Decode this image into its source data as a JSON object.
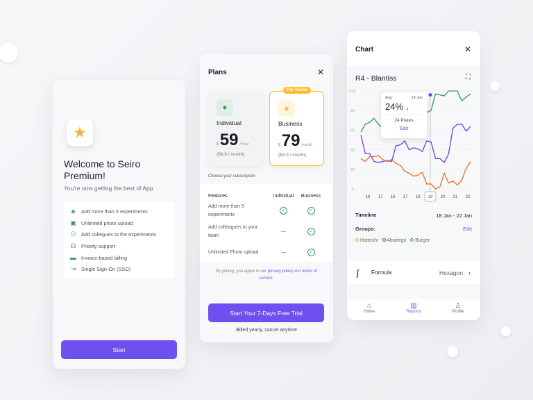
{
  "welcome": {
    "icon": "star-icon",
    "title": "Welcome to Seiro Premium!",
    "subtitle": "You're now getting the best of App",
    "features": [
      {
        "icon": "layers-icon",
        "label": "Add more than 5 experiments"
      },
      {
        "icon": "image-icon",
        "label": "Unlimited photo upload"
      },
      {
        "icon": "user-plus-icon",
        "label": "Add collegues to the experiments"
      },
      {
        "icon": "headset-icon",
        "label": "Priority support"
      },
      {
        "icon": "gift-card-icon",
        "label": "Invoice-based billing"
      },
      {
        "icon": "login-icon",
        "label": "Single Sign-On (SSO)"
      }
    ],
    "start_label": "Start"
  },
  "plans": {
    "title": "Plans",
    "individual": {
      "name": "Individual",
      "currency": "$",
      "price": "59",
      "period": "/ Year",
      "monthly": "($6.9 / month)"
    },
    "business": {
      "badge": "For Teams",
      "name": "Business",
      "currency": "$",
      "price": "79",
      "period": "/month",
      "monthly": "($8.9 / month)"
    },
    "choose": "Choose your subscription",
    "table": {
      "headers": [
        "Features",
        "Individual",
        "Business"
      ],
      "rows": [
        {
          "feature": "Add more than 5 experiments",
          "individual": true,
          "business": true
        },
        {
          "feature": "Add colleagues to your team",
          "individual": false,
          "business": true
        },
        {
          "feature": "Unlimited Photo upload",
          "individual": false,
          "business": true
        }
      ]
    },
    "legal": {
      "pre": "By joining, you agree to our ",
      "privacy": "privacy policy",
      "mid": " and ",
      "terms": "terms of service",
      "post": "."
    },
    "cta": "Start Your 7-Days Free Trial",
    "billing": "Billed yearly, cancel anytime"
  },
  "chart": {
    "title": "Chart",
    "subtitle": "R4 - Blantiss",
    "tooltip": {
      "label": "Avg:",
      "date": "19 Jan",
      "value": "24%",
      "plates": "24 Plates",
      "edit": "Edit"
    },
    "timeline_label": "Timeline",
    "timeline_value": "18 Jan - 22 Jan",
    "groups_label": "Groups:",
    "groups_edit": "Edit",
    "groups": [
      {
        "name": "Hottechi",
        "color": "#f5a623"
      },
      {
        "name": "Abstergo",
        "color": "#e02424"
      },
      {
        "name": "Burger",
        "color": "#2f9a5c"
      }
    ],
    "formula_label": "Formula",
    "formula_value": "Hexagon",
    "nav": [
      {
        "label": "Home",
        "icon": "home-icon"
      },
      {
        "label": "Reports",
        "icon": "bar-chart-icon",
        "active": true
      },
      {
        "label": "Profile",
        "icon": "user-icon"
      }
    ]
  },
  "chart_data": {
    "type": "line",
    "categories": [
      "18",
      "17",
      "16",
      "17",
      "18",
      "19",
      "20",
      "21",
      "22"
    ],
    "highlight": "19",
    "ylim": [
      0,
      100
    ],
    "yticks": [
      0,
      20,
      40,
      60,
      80,
      100
    ],
    "grid": true,
    "series": [
      {
        "color": "#2f9a5c",
        "values": [
          58,
          66,
          68,
          72,
          66,
          62,
          60,
          62,
          64,
          66,
          68,
          70,
          72,
          74,
          76,
          78,
          80,
          97,
          96,
          95,
          100,
          100,
          100,
          90,
          94,
          97
        ]
      },
      {
        "color": "#6e3cf5",
        "values": [
          55,
          36,
          36,
          28,
          27,
          28,
          29,
          28,
          44,
          45,
          49,
          40,
          42,
          41,
          38,
          49,
          48,
          31,
          31,
          27,
          36,
          62,
          66,
          66,
          59,
          64
        ]
      },
      {
        "color": "#f26b1d",
        "values": [
          31,
          28,
          33,
          33,
          34,
          30,
          28,
          30,
          26,
          24,
          18,
          16,
          13,
          14,
          17,
          5,
          5,
          0,
          2,
          16,
          6,
          8,
          4,
          9,
          21,
          28
        ]
      }
    ]
  }
}
